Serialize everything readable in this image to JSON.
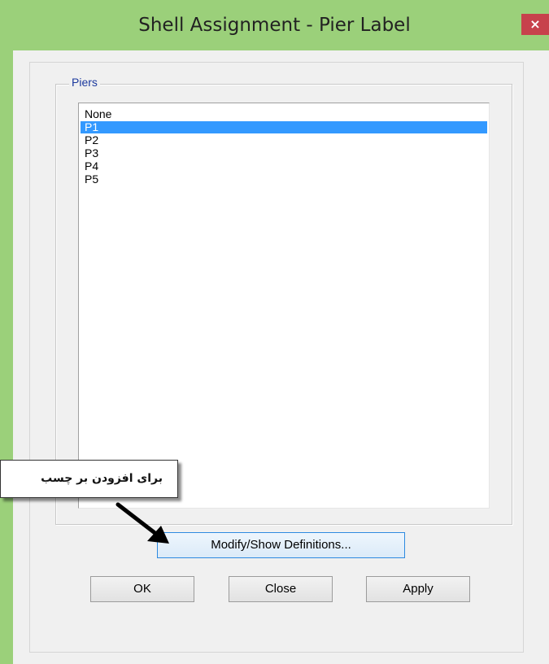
{
  "window": {
    "title": "Shell Assignment - Pier Label",
    "close_glyph": "×"
  },
  "group": {
    "title": "Piers",
    "items": [
      {
        "label": "None",
        "selected": false
      },
      {
        "label": "P1",
        "selected": true
      },
      {
        "label": "P2",
        "selected": false
      },
      {
        "label": "P3",
        "selected": false
      },
      {
        "label": "P4",
        "selected": false
      },
      {
        "label": "P5",
        "selected": false
      }
    ]
  },
  "buttons": {
    "modify": "Modify/Show Definitions...",
    "ok": "OK",
    "close": "Close",
    "apply": "Apply"
  },
  "callout": {
    "text": "برای افزودن بر چسب"
  },
  "colors": {
    "titlebar": "#9bd07a",
    "close_button": "#c7424c",
    "selection": "#3399ff",
    "group_title": "#1c3a9e"
  }
}
